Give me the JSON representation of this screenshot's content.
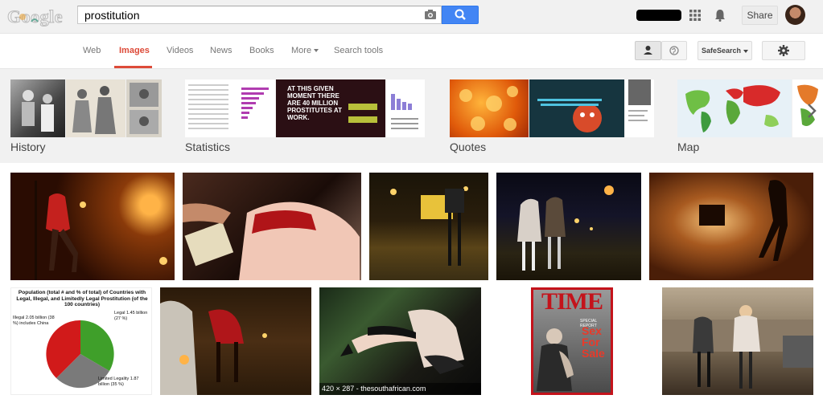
{
  "header": {
    "logo_text": "Google",
    "search": {
      "value": "prostitution"
    },
    "share_label": "Share",
    "icons": [
      "camera-icon",
      "search-icon",
      "apps-icon",
      "bell-icon"
    ]
  },
  "nav": {
    "tabs": [
      {
        "label": "Web"
      },
      {
        "label": "Images",
        "active": true
      },
      {
        "label": "Videos"
      },
      {
        "label": "News"
      },
      {
        "label": "Books"
      },
      {
        "label": "More"
      },
      {
        "label": "Search tools"
      }
    ],
    "safesearch_label": "SafeSearch",
    "colors": {
      "active_tab": "#dd4b39",
      "search_button": "#4285f4"
    }
  },
  "related": [
    {
      "label": "History"
    },
    {
      "label": "Statistics",
      "thumb_text": "AT THIS GIVEN MOMENT THERE ARE 40 MILLION PROSTITUTES AT WORK."
    },
    {
      "label": "Quotes"
    },
    {
      "label": "Map"
    }
  ],
  "results": {
    "chart_thumb": {
      "title": "Population (total # and % of total) of Countries with Legal, Illegal, and Limitedly Legal Prostitution (of the 100 countries)",
      "illegal": "Illegal 2.05 billion (38 %) includes China",
      "legal": "Legal 1.45 billion (27 %)",
      "limited": "Limited Legality 1.87 billion (35 %)"
    },
    "hover_caption": "420 × 287 - thesouthafrican.com",
    "time_cover": {
      "masthead": "TIME",
      "headline": "Sex For Sale",
      "kicker": "SPECIAL REPORT"
    }
  }
}
